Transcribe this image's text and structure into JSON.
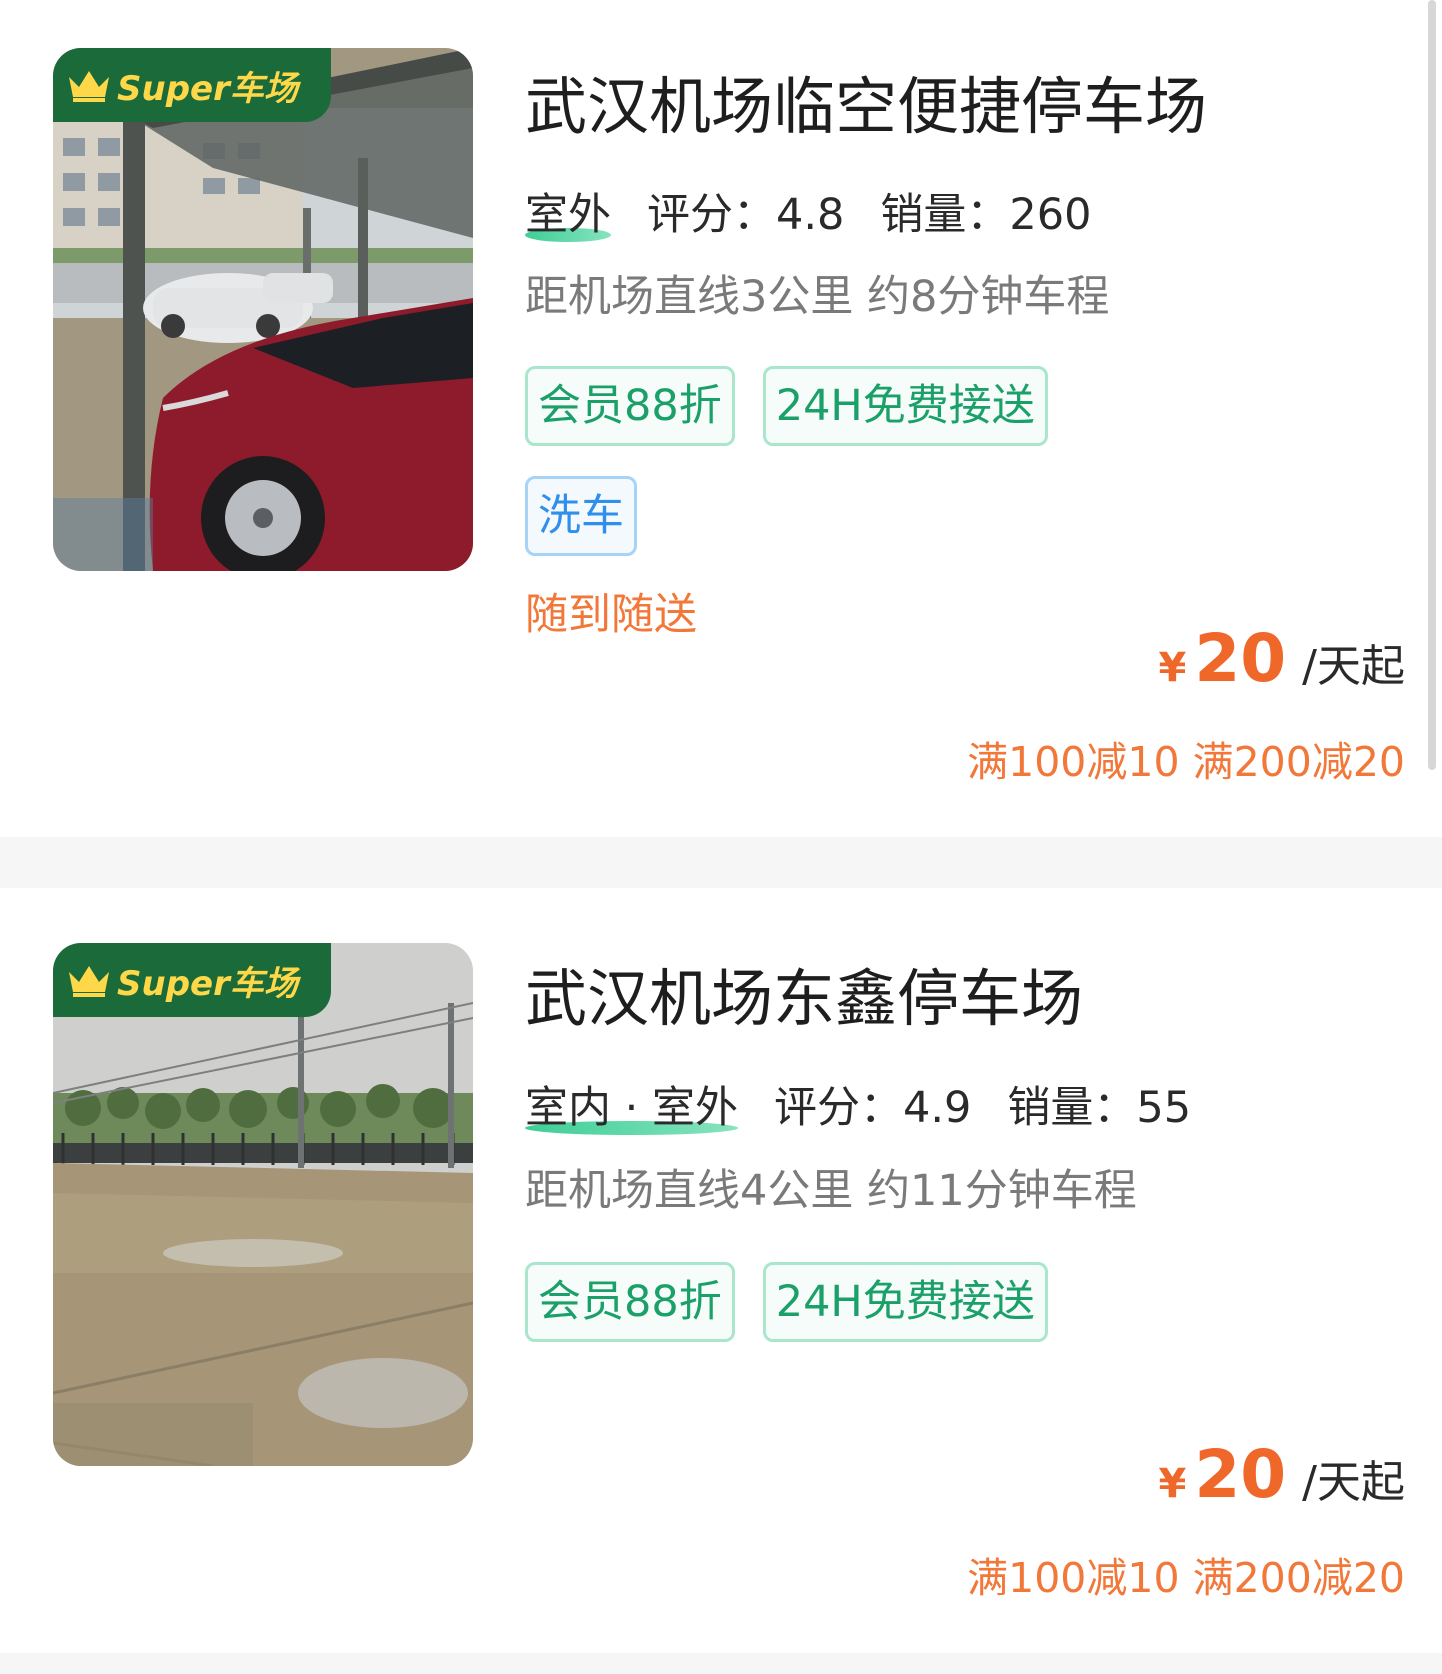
{
  "badge_text": "Super车场",
  "lots": [
    {
      "title": "武汉机场临空便捷停车场",
      "environment": "室外",
      "rating_label": "评分：4.8",
      "sales_label": "销量：260",
      "distance": "距机场直线3公里 约8分钟车程",
      "tags": [
        {
          "label": "会员88折",
          "color": "green"
        },
        {
          "label": "24H免费接送",
          "color": "green"
        },
        {
          "label": "洗车",
          "color": "blue"
        }
      ],
      "service": "随到随送",
      "currency": "¥",
      "price": "20",
      "price_unit": "/天起",
      "promo": "满100减10 满200减20"
    },
    {
      "title": "武汉机场东鑫停车场",
      "environment": "室内 · 室外",
      "rating_label": "评分：4.9",
      "sales_label": "销量：55",
      "distance": "距机场直线4公里 约11分钟车程",
      "tags": [
        {
          "label": "会员88折",
          "color": "green"
        },
        {
          "label": "24H免费接送",
          "color": "green"
        }
      ],
      "currency": "¥",
      "price": "20",
      "price_unit": "/天起",
      "promo": "满100减10 满200减20"
    }
  ],
  "colors": {
    "accent_orange": "#f0672a",
    "tag_green": "#1aa068",
    "tag_blue": "#2f8fea",
    "badge_green": "#1b6a3a",
    "badge_gold": "#ffd84a"
  }
}
